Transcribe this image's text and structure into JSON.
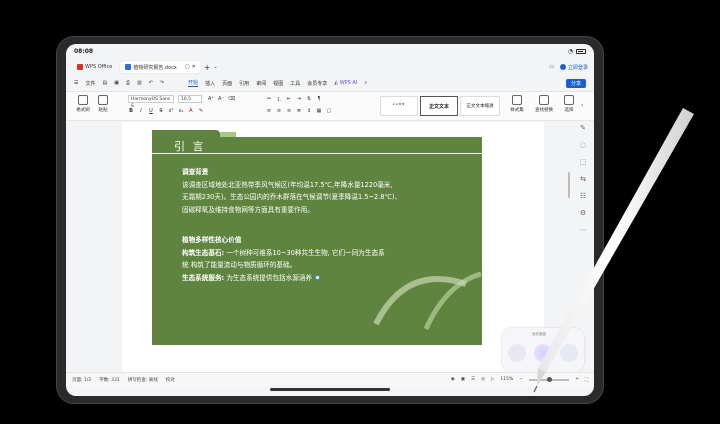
{
  "status": {
    "time": "08:08"
  },
  "tabs": [
    {
      "label": "WPS Office",
      "color": "#d9302b"
    },
    {
      "label": "植物研究报告.docx",
      "color": "#2f6de0"
    }
  ],
  "tab_actions": {
    "add": "+",
    "login": "立即登录"
  },
  "menu": {
    "file": "文件",
    "items": [
      "开始",
      "插入",
      "页面",
      "引用",
      "审阅",
      "视图",
      "工具",
      "会员专享",
      "WPS AI"
    ],
    "active": "开始",
    "share": "分享"
  },
  "ribbon": {
    "format_painter": "格式刷",
    "paste": "粘贴",
    "font_name": "HarmonyOS Sans S",
    "font_size": "10.5",
    "bold": "B",
    "italic": "I",
    "underline": "U",
    "styles": [
      "正文文本",
      "正文文本缩进"
    ],
    "style_panel": "样式集",
    "find_replace": "查找替换",
    "select": "选择"
  },
  "document": {
    "section_title": "引 言",
    "para1_heading": "调查背景",
    "para1_lines": [
      "该调查区域地处北亚热带季风气候区(年均温17.5℃,年降水量1220毫米,",
      "无霜期230天)。生态公园内的乔木群落在气候调节(夏季降温1.5~2.8℃)、",
      "固碳释氧及维持食物网等方面具有重要作用。"
    ],
    "para2_heading": "植物多样性核心价值",
    "para2_line1_label": "构筑生态基石:",
    "para2_line1": "一个树种可维系10~30种共生生物, 它们一同为生态系",
    "para2_line2": "统 构筑了能量流动与物质循环的基础。",
    "para3_label": "生态系统服务:",
    "para3_text": "为生态系统提供包括水源涵养"
  },
  "float_widget": {
    "label": "迷你键盘"
  },
  "bottom": {
    "page": "页面: 1/2",
    "words": "字数: 331",
    "spell": "拼写检查: 离线",
    "proof": "校对",
    "zoom": "115%"
  },
  "colors": {
    "accent": "#1a5fd0",
    "panel_green": "#5e8440",
    "panel_tab_light": "#a9c785"
  }
}
